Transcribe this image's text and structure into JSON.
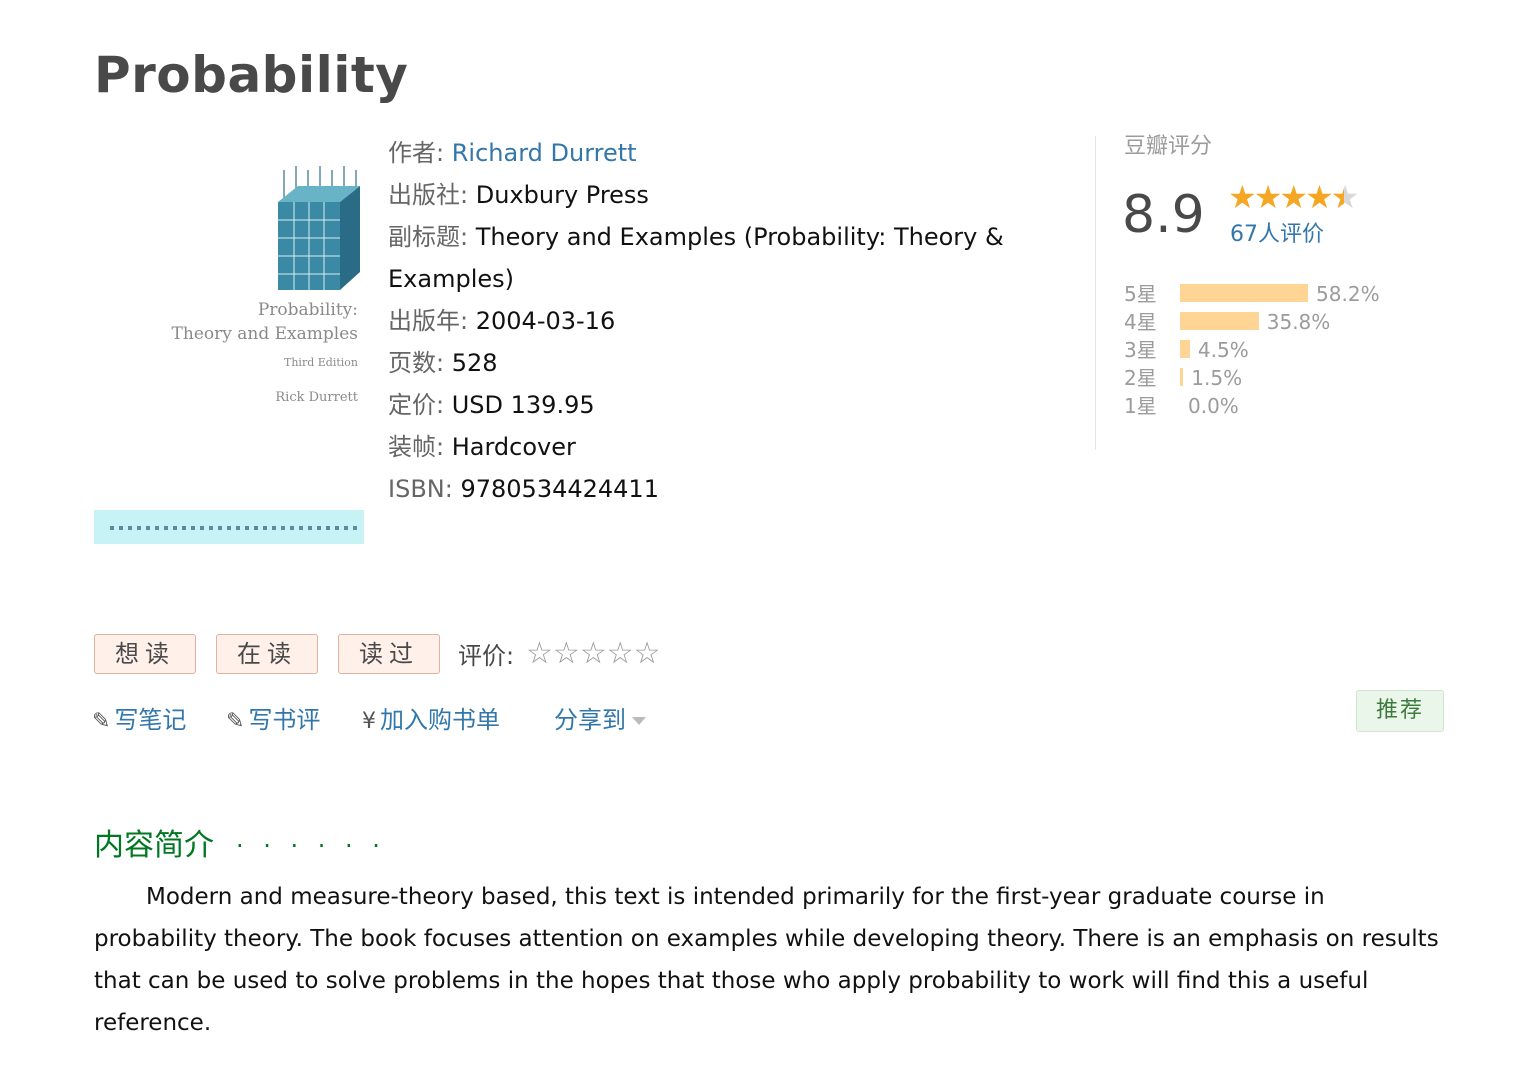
{
  "title": "Probability",
  "cover": {
    "line1": "Probability:",
    "line2": "Theory and Examples",
    "line3": "Third Edition",
    "line4": "Rick Durrett"
  },
  "info": {
    "author_label": "作者:",
    "author": "Richard Durrett",
    "publisher_label": "出版社:",
    "publisher": "Duxbury Press",
    "subtitle_label": "副标题:",
    "subtitle": "Theory and Examples (Probability: Theory & Examples)",
    "pubyear_label": "出版年:",
    "pubyear": "2004-03-16",
    "pages_label": "页数:",
    "pages": "528",
    "price_label": "定价:",
    "price": "USD 139.95",
    "binding_label": "装帧:",
    "binding": "Hardcover",
    "isbn_label": "ISBN:",
    "isbn": "9780534424411"
  },
  "rating": {
    "label": "豆瓣评分",
    "score": "8.9",
    "stars_value": 4.5,
    "count": "67人评价",
    "distribution": [
      {
        "label": "5星",
        "percent": "58.2%",
        "value": 58.2
      },
      {
        "label": "4星",
        "percent": "35.8%",
        "value": 35.8
      },
      {
        "label": "3星",
        "percent": "4.5%",
        "value": 4.5
      },
      {
        "label": "2星",
        "percent": "1.5%",
        "value": 1.5
      },
      {
        "label": "1星",
        "percent": "0.0%",
        "value": 0.0
      }
    ]
  },
  "actions": {
    "want": "想读",
    "reading": "在读",
    "read": "读过",
    "rate_label": "评价:",
    "write_note": "写笔记",
    "write_review": "写书评",
    "add_to_cart": "加入购书单",
    "share": "分享到",
    "recommend": "推荐"
  },
  "icons": {
    "pencil": "pencil-icon",
    "yen": "yen-icon",
    "star": "star-icon"
  },
  "intro": {
    "heading": "内容简介",
    "dots": "· · · · · ·",
    "text": "Modern and measure-theory based, this text is intended primarily for the first-year graduate course in probability theory. The book focuses attention on examples while developing theory. There is an emphasis on results that can be used to solve problems in the hopes that those who apply probability to work will find this a useful reference."
  },
  "colors": {
    "link": "#3377aa",
    "star": "#f5a623",
    "bar": "#ffd596",
    "intro_heading": "#007722"
  }
}
